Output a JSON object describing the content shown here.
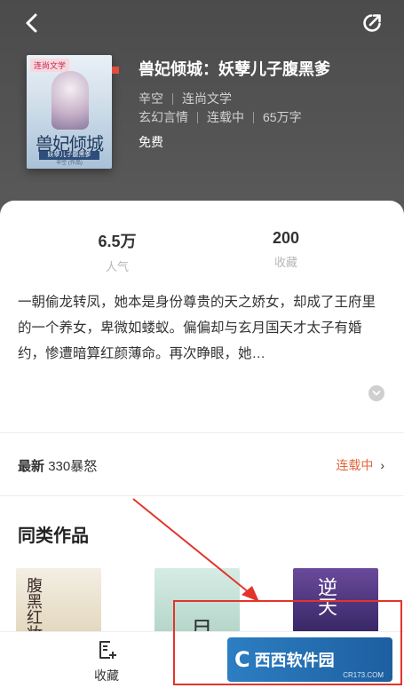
{
  "book": {
    "title": "兽妃倾城：妖孽儿子腹黑爹",
    "author": "辛空",
    "publisher": "连尚文学",
    "genre": "玄幻言情",
    "status": "连载中",
    "word_count": "65万字",
    "price": "免费",
    "cover": {
      "tag": "连尚文学",
      "title_text": "兽妃倾城",
      "subtitle_text": "妖孽儿子腹黑爹",
      "author_text": "辛空 (作品)"
    }
  },
  "stats": {
    "popularity_value": "6.5万",
    "popularity_label": "人气",
    "favorites_value": "200",
    "favorites_label": "收藏"
  },
  "description": "一朝偷龙转凤，她本是身份尊贵的天之娇女，却成了王府里的一个养女，卑微如蝼蚁。偏偏却与玄月国天才太子有婚约，惨遭暗算红颜薄命。再次睁眼，她…",
  "latest": {
    "label": "最新",
    "chapter": "330暴怒",
    "status": "连载中",
    "chevron": "›"
  },
  "similar": {
    "title": "同类作品",
    "books": [
      {
        "cover_text": "腹黑红妆"
      },
      {
        "cover_text": "月"
      },
      {
        "cover_text": "逆天"
      }
    ]
  },
  "bottom_bar": {
    "favorite_label": "收藏"
  },
  "watermark": {
    "text": "西西软件园",
    "url": "CR173.COM"
  },
  "icons": {
    "back": "back-arrow-icon",
    "share": "share-icon",
    "expand": "chevron-down-icon",
    "favorite": "add-to-shelf-icon"
  },
  "colors": {
    "header_bg": "#4b4b4b",
    "accent_orange": "#e0663e",
    "annotation_red": "#e3342c",
    "watermark_blue": "#2c7ec2"
  }
}
